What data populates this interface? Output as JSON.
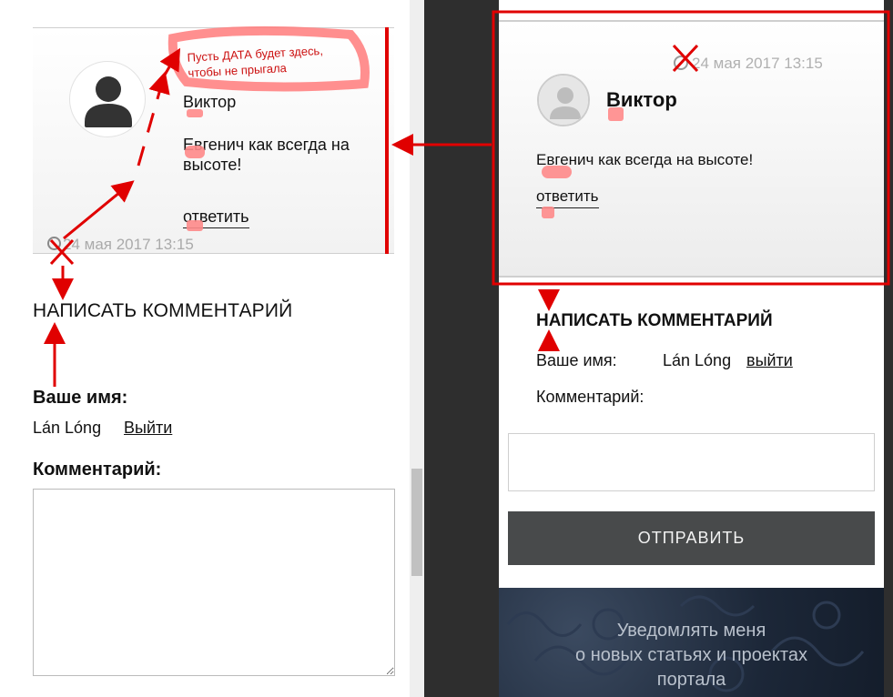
{
  "left": {
    "comment": {
      "author": "Виктор",
      "text": "Евгенич как всегда на высоте!",
      "reply": "ответить",
      "date": "24 мая 2017 13:15"
    },
    "write_title": "НАПИСАТЬ КОММЕНТАРИЙ",
    "name_label": "Ваше имя:",
    "user_name": "Lán Lóng",
    "logout": "Выйти",
    "comment_label": "Комментарий:"
  },
  "right": {
    "comment": {
      "date": "24 мая 2017  13:15",
      "author": "Виктор",
      "text": "Евгенич как всегда на высоте!",
      "reply": "ответить"
    },
    "write_title": "НАПИСАТЬ КОММЕНТАРИЙ",
    "name_label": "Ваше имя:",
    "user_name": "Lán Lóng",
    "logout": "выйти",
    "comment_label": "Комментарий:",
    "submit": "ОТПРАВИТЬ",
    "banner": {
      "line1": "Уведомлять меня",
      "line2": "о новых статьях и проектах",
      "line3": "портала"
    }
  },
  "annotation": {
    "note": "Пусть ДАТА будет здесь, чтобы не прыгала",
    "color": "#e00000"
  }
}
